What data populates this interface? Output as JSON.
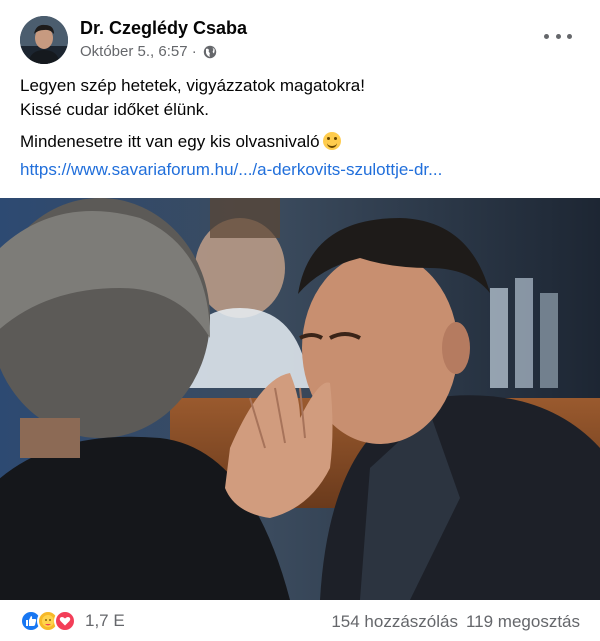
{
  "post": {
    "author": "Dr. Czeglédy Csaba",
    "timestamp": "Október 5., 6:57 ·",
    "privacy_icon": "globe-icon",
    "more_icon": "more-dots-icon",
    "lines": [
      "Legyen szép hetetek, vigyázzatok magatokra!",
      "Kissé cudar időket élünk.",
      "Mindenesetre itt van egy kis olvasnivaló"
    ],
    "link": "https://www.savariaforum.hu/.../a-derkovits-szulottje-dr..."
  },
  "reactions": {
    "icons": [
      "like-icon",
      "care-icon",
      "love-icon"
    ],
    "count": "1,7 E",
    "comments": "154 hozzászólás",
    "shares": "119 megosztás"
  },
  "colors": {
    "link": "#216fdb",
    "secondary_text": "#65676b",
    "like": "#1877f2",
    "love": "#f33e58",
    "care": "#f7b928"
  }
}
